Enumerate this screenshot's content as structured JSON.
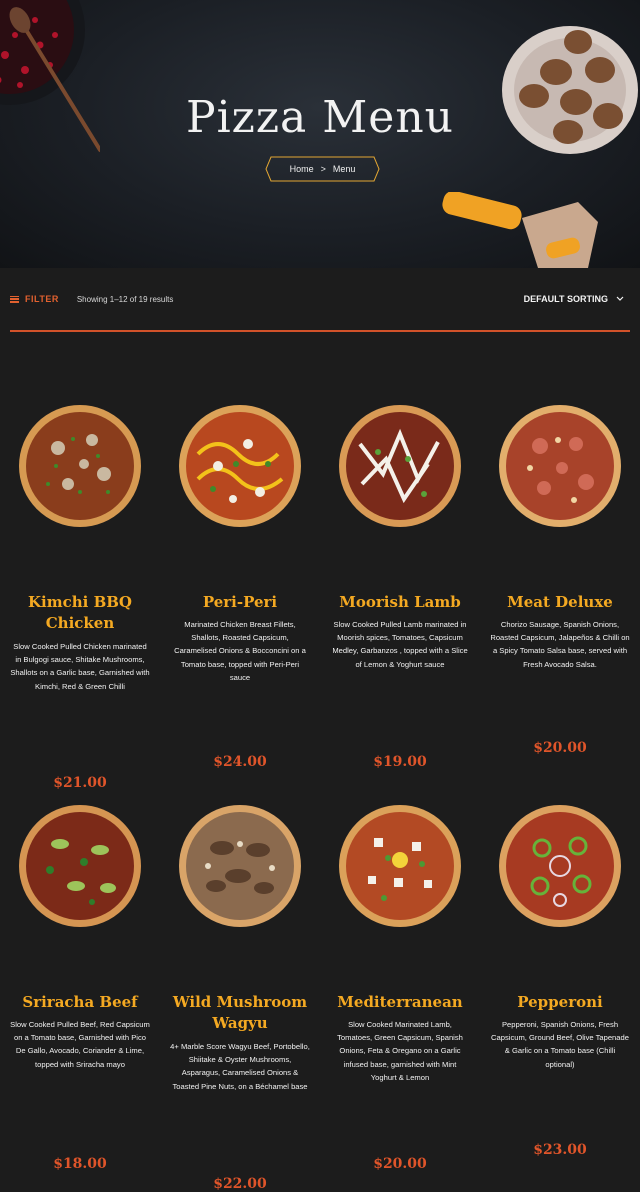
{
  "hero": {
    "title": "Pizza Menu",
    "breadcrumb": {
      "home": "Home",
      "separator": ">",
      "current": "Menu"
    }
  },
  "toolbar": {
    "filter_label": "FILTER",
    "results_text": "Showing 1–12 of 19 results",
    "sorting_label": "DEFAULT SORTING"
  },
  "colors": {
    "accent": "#e0552a",
    "title": "#f4a922",
    "background": "#1c1c1c"
  },
  "products": [
    {
      "name": "Kimchi BBQ Chicken",
      "description": "Slow Cooked Pulled Chicken marinated in Bulgogi sauce, Shitake Mushrooms, Shallots on a Garlic base, Garnished with Kimchi, Red & Green Chilli",
      "price": "$21.00"
    },
    {
      "name": "Peri-Peri",
      "description": "Marinated Chicken Breast Fillets, Shallots, Roasted Capsicum, Caramelised Onions & Bocconcini on a Tomato base, topped with Peri-Peri sauce",
      "price": "$24.00"
    },
    {
      "name": "Moorish Lamb",
      "description": "Slow Cooked Pulled Lamb marinated in Moorish spices, Tomatoes, Capsicum Medley, Garbanzos , topped with a Slice of Lemon & Yoghurt sauce",
      "price": "$19.00"
    },
    {
      "name": "Meat Deluxe",
      "description": "Chorizo Sausage, Spanish Onions, Roasted Capsicum, Jalapeños & Chilli on a Spicy Tomato Salsa base, served with Fresh Avocado Salsa.",
      "price": "$20.00"
    },
    {
      "name": "Sriracha Beef",
      "description": "Slow Cooked Pulled Beef, Red Capsicum on a Tomato base, Garnished with Pico De Gallo, Avocado, Coriander & Lime, topped with Sriracha mayo",
      "price": "$18.00"
    },
    {
      "name": "Wild Mushroom Wagyu",
      "description": "4+ Marble Score Wagyu Beef, Portobello, Shiitake & Oyster Mushrooms, Asparagus, Caramelised Onions & Toasted Pine Nuts, on a Béchamel base",
      "price": "$22.00"
    },
    {
      "name": "Mediterranean",
      "description": "Slow Cooked Marinated Lamb, Tomatoes, Green Capsicum, Spanish Onions, Feta & Oregano on a Garlic infused base, garnished with Mint Yoghurt & Lemon",
      "price": "$20.00"
    },
    {
      "name": "Pepperoni",
      "description": "Pepperoni, Spanish Onions, Fresh Capsicum, Ground Beef, Olive Tapenade & Garlic on a Tomato base (Chilli optional)",
      "price": "$23.00"
    }
  ]
}
